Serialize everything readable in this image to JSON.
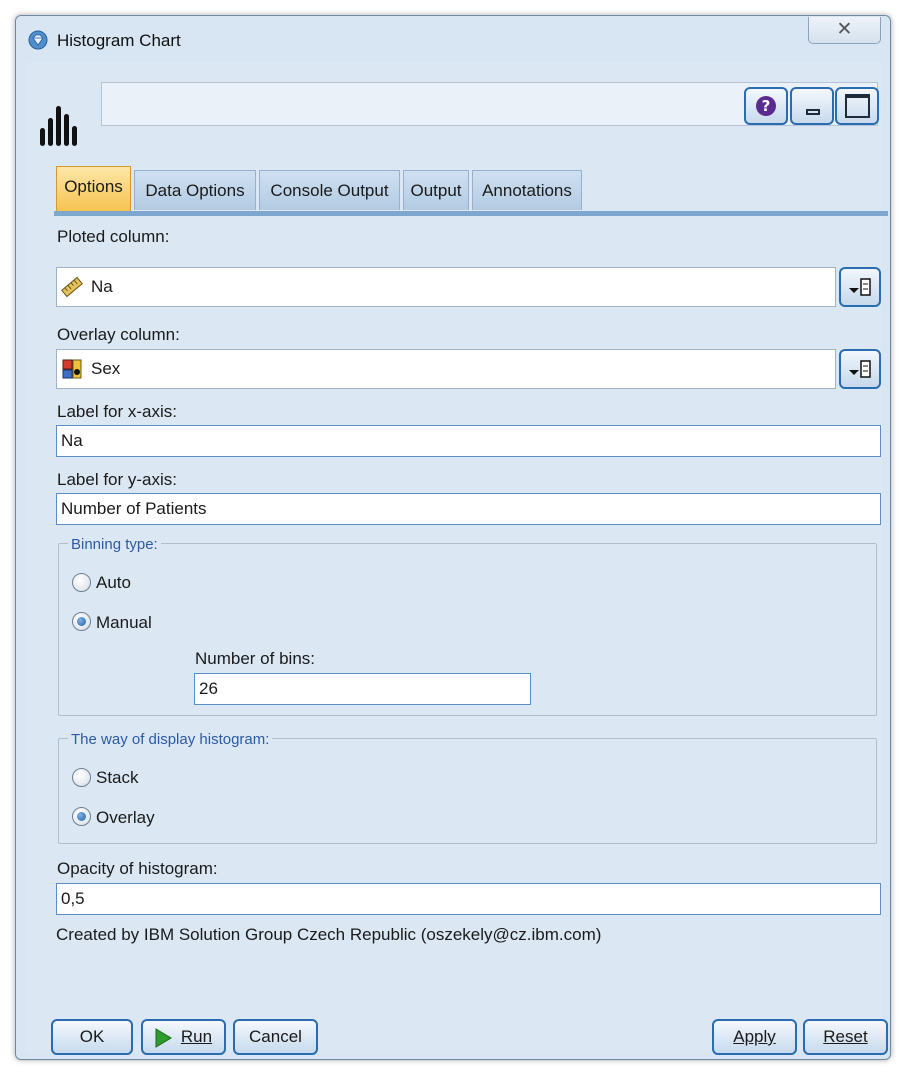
{
  "window": {
    "title": "Histogram Chart",
    "close_glyph": "✕"
  },
  "header_buttons": {
    "help_glyph": "?",
    "help_icon": "help-icon",
    "minimize_icon": "minimize-icon",
    "maximize_icon": "maximize-icon"
  },
  "tabs": [
    {
      "label": "Options",
      "active": true
    },
    {
      "label": "Data Options"
    },
    {
      "label": "Console Output"
    },
    {
      "label": "Output"
    },
    {
      "label": "Annotations"
    }
  ],
  "form": {
    "plotted_column_label": "Ploted column:",
    "plotted_column_value": "Na",
    "plotted_column_icon": "ruler-icon",
    "overlay_column_label": "Overlay column:",
    "overlay_column_value": "Sex",
    "overlay_column_icon": "set-icon",
    "x_axis_label": "Label for x-axis:",
    "x_axis_value": "Na",
    "y_axis_label": "Label for y-axis:",
    "y_axis_value": "Number of Patients",
    "binning": {
      "title": "Binning type:",
      "options": [
        "Auto",
        "Manual"
      ],
      "selected": "Manual",
      "bins_label": "Number of bins:",
      "bins_value": "26"
    },
    "display": {
      "title": "The way of display histogram:",
      "options": [
        "Stack",
        "Overlay"
      ],
      "selected": "Overlay"
    },
    "opacity_label": "Opacity of histogram:",
    "opacity_value": "0,5",
    "credit": "Created by IBM Solution Group Czech Republic (oszekely@cz.ibm.com)"
  },
  "buttons": {
    "ok": "OK",
    "run": "Run",
    "cancel": "Cancel",
    "apply": "Apply",
    "reset": "Reset"
  },
  "colors": {
    "active_tab": "#f6c24e",
    "accent_border": "#2a6cb0",
    "run_icon": "#2e9b2e"
  }
}
